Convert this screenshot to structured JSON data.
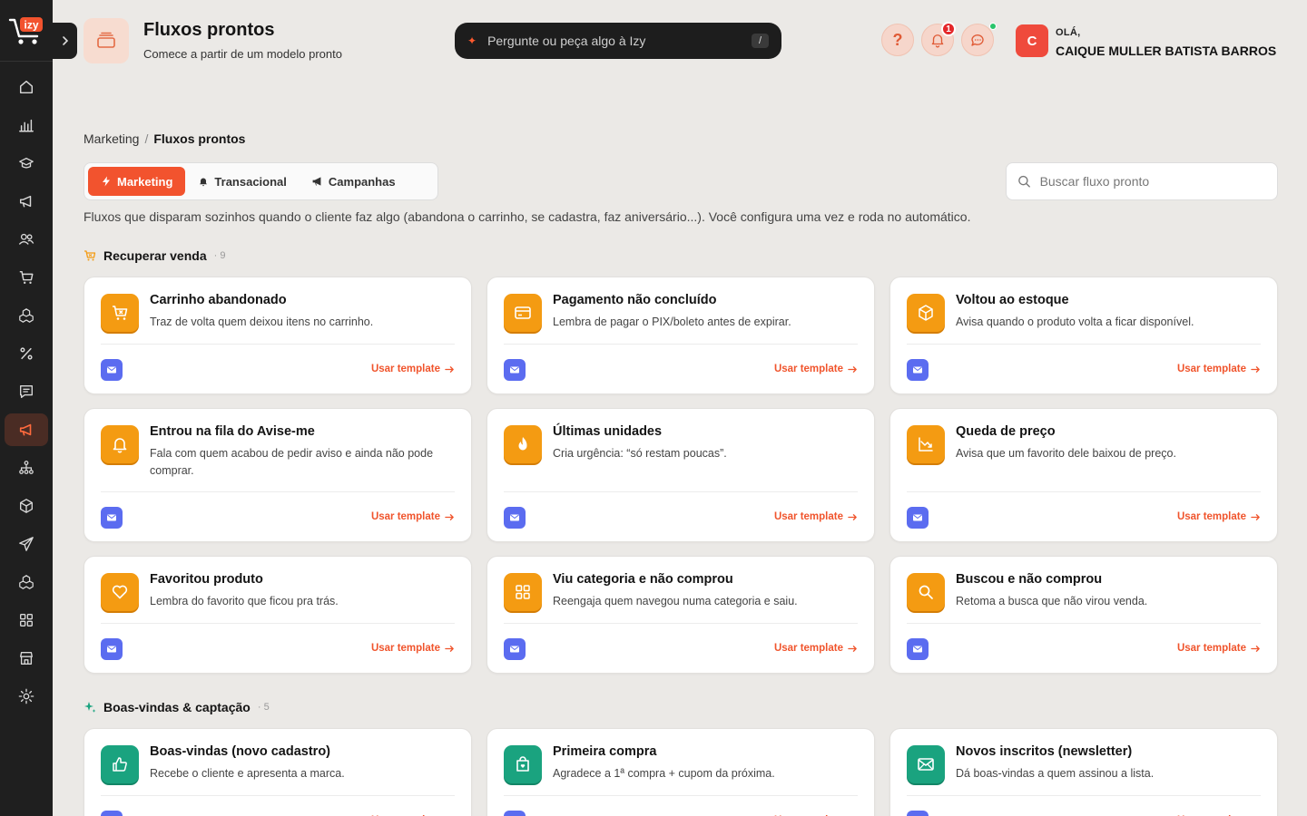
{
  "brand": {
    "logo_text": "izy",
    "accent": "#f2532e"
  },
  "sidebar": {
    "items": [
      {
        "name": "home-icon"
      },
      {
        "name": "chart-icon"
      },
      {
        "name": "graduation-cap-icon"
      },
      {
        "name": "megaphone-icon"
      },
      {
        "name": "users-icon"
      },
      {
        "name": "cart-icon"
      },
      {
        "name": "cubes-icon"
      },
      {
        "name": "percent-icon"
      },
      {
        "name": "message-icon"
      },
      {
        "name": "marketing-megaphone-icon",
        "active": true
      },
      {
        "name": "network-icon"
      },
      {
        "name": "box-icon"
      },
      {
        "name": "send-icon"
      },
      {
        "name": "blocks-icon"
      },
      {
        "name": "grid-icon"
      },
      {
        "name": "store-icon"
      },
      {
        "name": "settings-icon"
      }
    ]
  },
  "header": {
    "title": "Fluxos prontos",
    "subtitle": "Comece a partir de um modelo pronto",
    "ai_placeholder": "Pergunte ou peça algo à Izy",
    "ai_shortcut": "/",
    "help_label": "?",
    "notifications_count": "1",
    "greeting": "OLÁ,",
    "user_initial": "C",
    "user_name": "CAIQUE MULLER BATISTA BARROS"
  },
  "breadcrumb": {
    "parent": "Marketing",
    "separator": "/",
    "current": "Fluxos prontos"
  },
  "tabs": [
    {
      "label": "Marketing",
      "icon": "bolt-icon",
      "active": true
    },
    {
      "label": "Transacional",
      "icon": "bell-icon",
      "active": false
    },
    {
      "label": "Campanhas",
      "icon": "megaphone-icon",
      "active": false
    }
  ],
  "search": {
    "placeholder": "Buscar fluxo pronto"
  },
  "description": "Fluxos que disparam sozinhos quando o cliente faz algo (abandona o carrinho, se cadastra, faz aniversário...). Você configura uma vez e roda no automático.",
  "sections": [
    {
      "title": "Recuperar venda",
      "count": "· 9",
      "cards": [
        {
          "title": "Carrinho abandonado",
          "desc": "Traz de volta quem deixou itens no carrinho.",
          "icon": "cart-x-icon"
        },
        {
          "title": "Pagamento não concluído",
          "desc": "Lembra de pagar o PIX/boleto antes de expirar.",
          "icon": "credit-card-icon"
        },
        {
          "title": "Voltou ao estoque",
          "desc": "Avisa quando o produto volta a ficar disponível.",
          "icon": "box-icon"
        },
        {
          "title": "Entrou na fila do Avise-me",
          "desc": "Fala com quem acabou de pedir aviso e ainda não pode comprar.",
          "icon": "bell-icon"
        },
        {
          "title": "Últimas unidades",
          "desc": "Cria urgência: “só restam poucas”.",
          "icon": "flame-icon"
        },
        {
          "title": "Queda de preço",
          "desc": "Avisa que um favorito dele baixou de preço.",
          "icon": "trending-down-icon"
        },
        {
          "title": "Favoritou produto",
          "desc": "Lembra do favorito que ficou pra trás.",
          "icon": "heart-icon"
        },
        {
          "title": "Viu categoria e não comprou",
          "desc": "Reengaja quem navegou numa categoria e saiu.",
          "icon": "grid-icon"
        },
        {
          "title": "Buscou e não comprou",
          "desc": "Retoma a busca que não virou venda.",
          "icon": "search-icon"
        }
      ]
    },
    {
      "title": "Boas-vindas & captação",
      "count": "· 5",
      "cards": [
        {
          "title": "Boas-vindas (novo cadastro)",
          "desc": "Recebe o cliente e apresenta a marca.",
          "icon": "thumbs-up-icon"
        },
        {
          "title": "Primeira compra",
          "desc": "Agradece a 1ª compra + cupom da próxima.",
          "icon": "shopping-bag-icon"
        },
        {
          "title": "Novos inscritos (newsletter)",
          "desc": "Dá boas-vindas a quem assinou a lista.",
          "icon": "newsletter-icon"
        }
      ]
    }
  ],
  "card_action_label": "Usar template",
  "channel_icon": "mail-icon"
}
